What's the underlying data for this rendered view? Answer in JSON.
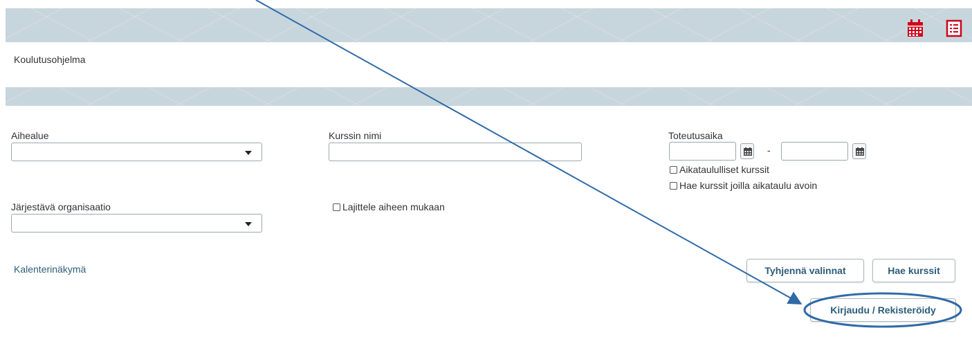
{
  "header": {
    "icons": [
      "calendar-icon",
      "list-icon"
    ],
    "accent_color": "#d0021b"
  },
  "page": {
    "title": "Koulutusohjelma"
  },
  "filters": {
    "topic": {
      "label": "Aihealue",
      "value": ""
    },
    "course_name": {
      "label": "Kurssin nimi",
      "value": ""
    },
    "period": {
      "label": "Toteutusaika",
      "from": "",
      "separator": "-",
      "to": "",
      "scheduled_label": "Aikataululliset kurssit",
      "open_schedule_label": "Hae kurssit joilla aikataulu avoin"
    },
    "organizer": {
      "label": "Järjestävä organisaatio",
      "value": ""
    },
    "sort_by_topic_label": "Lajittele aiheen mukaan"
  },
  "actions": {
    "calendar_view_link": "Kalenterinäkymä",
    "clear_label": "Tyhjennä valinnat",
    "search_label": "Hae kurssit",
    "login_label": "Kirjaudu / Rekisteröidy"
  },
  "annotation": {
    "color": "#2f6aa8"
  }
}
